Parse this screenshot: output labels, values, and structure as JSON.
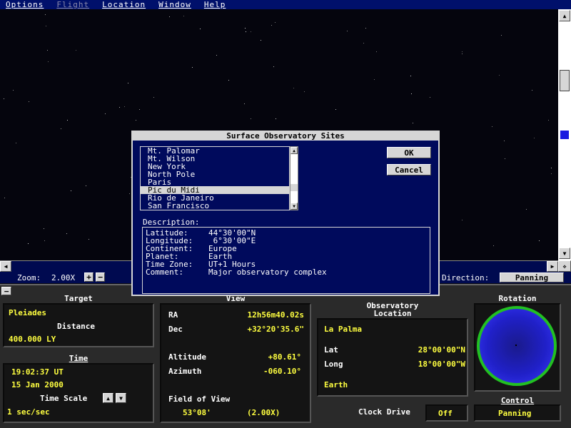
{
  "menu": [
    {
      "label": "Options",
      "disabled": false
    },
    {
      "label": "Flight",
      "disabled": true
    },
    {
      "label": "Location",
      "disabled": false
    },
    {
      "label": "Window",
      "disabled": false
    },
    {
      "label": "Help",
      "disabled": false
    }
  ],
  "zoom": {
    "label": "Zoom:",
    "value": "2.00X",
    "plus": "+",
    "minus": "−"
  },
  "direction": {
    "label": "Direction:",
    "value": "Panning"
  },
  "dialog": {
    "title": "Surface Observatory Sites",
    "sites": [
      "Mt. Palomar",
      "Mt. Wilson",
      "New York",
      "North Pole",
      "Paris",
      "Pic du Midi",
      "Rio de Janeiro",
      "San Francisco"
    ],
    "selected_index": 5,
    "ok": "OK",
    "cancel": "Cancel",
    "description_label": "Description:",
    "description": [
      {
        "key": "Latitude:",
        "value": "44°30'00\"N"
      },
      {
        "key": "Longitude:",
        "value": " 6°30'00\"E"
      },
      {
        "key": "Continent:",
        "value": "Europe"
      },
      {
        "key": "Planet:",
        "value": "Earth"
      },
      {
        "key": "Time Zone:",
        "value": "UT+1 Hours"
      },
      {
        "key": "Comment:",
        "value": "Major observatory complex"
      }
    ]
  },
  "target": {
    "header": "Target",
    "name": "Pleiades",
    "distance_label": "Distance",
    "distance": "400.000 LY"
  },
  "time": {
    "header": "Time",
    "clock": "19:02:37 UT",
    "date": "15 Jan 2000",
    "scale_label": "Time Scale",
    "scale": "1 sec/sec"
  },
  "view": {
    "header": "View",
    "ra_label": "RA",
    "ra": "12h56m40.02s",
    "dec_label": "Dec",
    "dec": "+32°20'35.6\"",
    "alt_label": "Altitude",
    "alt": "+80.61°",
    "az_label": "Azimuth",
    "az": "-060.10°",
    "fov_label": "Field of View",
    "fov": "53°08'",
    "fov_zoom": "(2.00X)"
  },
  "observatory": {
    "header1": "Observatory",
    "header2": "Location",
    "name": "La Palma",
    "lat_label": "Lat",
    "lat": "28°00'00\"N",
    "long_label": "Long",
    "long": "18°00'00\"W",
    "planet": "Earth"
  },
  "clock_drive": {
    "label": "Clock Drive",
    "value": "Off"
  },
  "rotation": {
    "header": "Rotation"
  },
  "control": {
    "header": "Control",
    "value": "Panning"
  },
  "colors": {
    "menu_bg": "#00106b",
    "dialog_bg": "#000a5c",
    "value_yellow": "#ffff40",
    "globe_ring": "#22c022"
  }
}
